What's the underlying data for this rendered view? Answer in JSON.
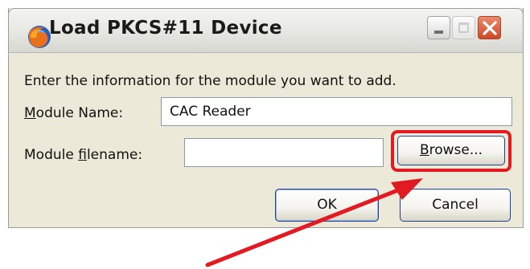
{
  "window": {
    "title": "Load PKCS#11 Device",
    "icon": "firefox-app-icon",
    "controls": [
      "minimize",
      "maximize",
      "close"
    ]
  },
  "form": {
    "instruction": "Enter the information for the module you want to add.",
    "module_name": {
      "label_pre": "",
      "label_mnemonic": "M",
      "label_post": "odule Name:",
      "value": "CAC Reader"
    },
    "module_filename": {
      "label_pre": "Module ",
      "label_mnemonic": "f",
      "label_post": "ilename:",
      "value": ""
    },
    "browse_button": {
      "label_pre": "",
      "label_mnemonic": "B",
      "label_post": "rowse..."
    }
  },
  "buttons": {
    "ok": "OK",
    "cancel": "Cancel"
  },
  "annotation": {
    "highlight_color": "#e21b23",
    "target": "browse-button"
  }
}
